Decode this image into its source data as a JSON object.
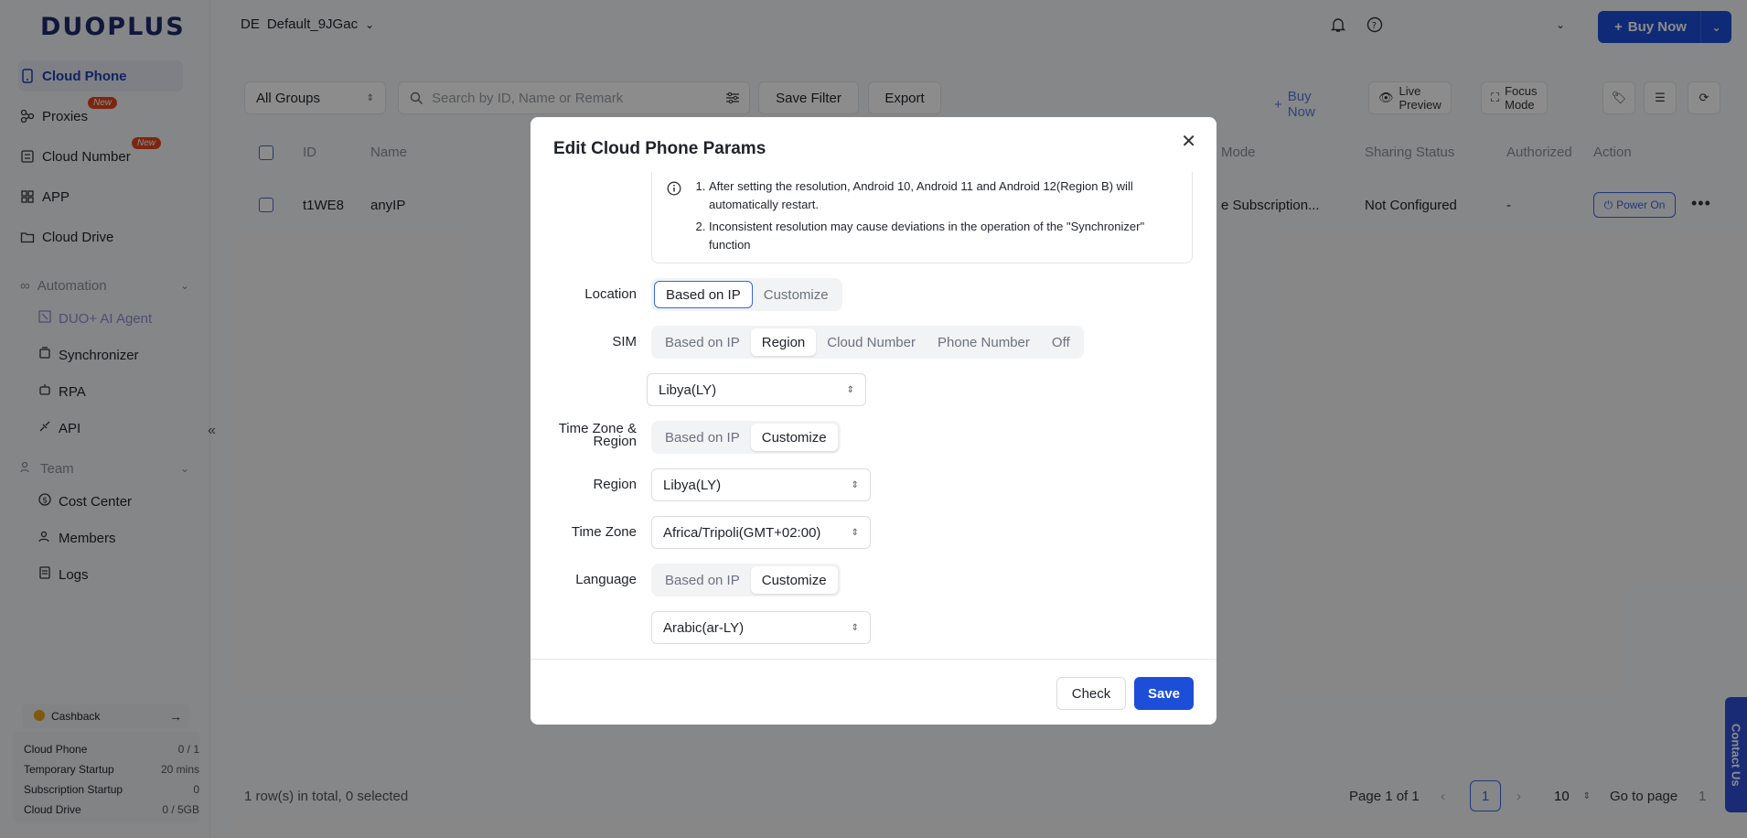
{
  "brand": {
    "logo": "DUOPLUS",
    "accent": "#1d4ed8"
  },
  "sidebar": {
    "items": [
      {
        "label": "Cloud Phone"
      },
      {
        "label": "Proxies",
        "badge": "New"
      },
      {
        "label": "Cloud Number",
        "badge": "New"
      },
      {
        "label": "APP"
      },
      {
        "label": "Cloud Drive"
      }
    ],
    "automation": {
      "label": "Automation",
      "items": [
        {
          "label": "DUO+ AI Agent"
        },
        {
          "label": "Synchronizer"
        },
        {
          "label": "RPA"
        },
        {
          "label": "API"
        }
      ]
    },
    "team": {
      "label": "Team",
      "items": [
        {
          "label": "Cost Center"
        },
        {
          "label": "Members"
        },
        {
          "label": "Logs"
        }
      ]
    },
    "cashback": "Cashback",
    "stats": [
      {
        "label": "Cloud Phone",
        "value": "0 / 1"
      },
      {
        "label": "Temporary Startup",
        "value": "20 mins"
      },
      {
        "label": "Subscription Startup",
        "value": "0"
      },
      {
        "label": "Cloud Drive",
        "value": "0 / 5GB"
      }
    ]
  },
  "header": {
    "ws_code": "DE",
    "ws_name": "Default_9JGac",
    "buy_now": "Buy Now"
  },
  "toolbar": {
    "group_select": "All Groups",
    "search_placeholder": "Search by ID, Name or Remark",
    "save_filter": "Save Filter",
    "export": "Export",
    "buy_now": "Buy Now",
    "live_preview": "Live Preview",
    "focus_mode": "Focus Mode"
  },
  "table": {
    "headers": {
      "id": "ID",
      "name": "Name",
      "mode": "Mode",
      "sharing": "Sharing Status",
      "authorized": "Authorized",
      "action": "Action"
    },
    "row": {
      "id": "t1WE8",
      "name": "anyIP",
      "mode": "e Subscription...",
      "sharing": "Not Configured",
      "authorized": "-",
      "action": "Power On"
    }
  },
  "footer": {
    "summary": "1 row(s) in total, 0 selected",
    "page_info": "Page 1 of 1",
    "current_page": "1",
    "per_page": "10",
    "go_to": "Go to page",
    "go_value": "1"
  },
  "contact": "Contact Us",
  "modal": {
    "title": "Edit Cloud Phone Params",
    "notice": [
      "After setting the resolution, Android 10, Android 11 and Android 12(Region B) will automatically restart.",
      "Inconsistent resolution may cause deviations in the operation of the \"Synchronizer\" function"
    ],
    "location": {
      "label": "Location",
      "options": [
        "Based on IP",
        "Customize"
      ],
      "selected": "Based on IP"
    },
    "sim": {
      "label": "SIM",
      "options": [
        "Based on IP",
        "Region",
        "Cloud Number",
        "Phone Number",
        "Off"
      ],
      "selected": "Region",
      "region_value": "Libya(LY)"
    },
    "timezone_region": {
      "label": "Time Zone & Region",
      "options": [
        "Based on IP",
        "Customize"
      ],
      "selected": "Customize"
    },
    "region": {
      "label": "Region",
      "value": "Libya(LY)"
    },
    "time_zone": {
      "label": "Time Zone",
      "value": "Africa/Tripoli(GMT+02:00)"
    },
    "language": {
      "label": "Language",
      "options": [
        "Based on IP",
        "Customize"
      ],
      "selected": "Customize",
      "value": "Arabic(ar-LY)"
    },
    "check": "Check",
    "save": "Save"
  }
}
